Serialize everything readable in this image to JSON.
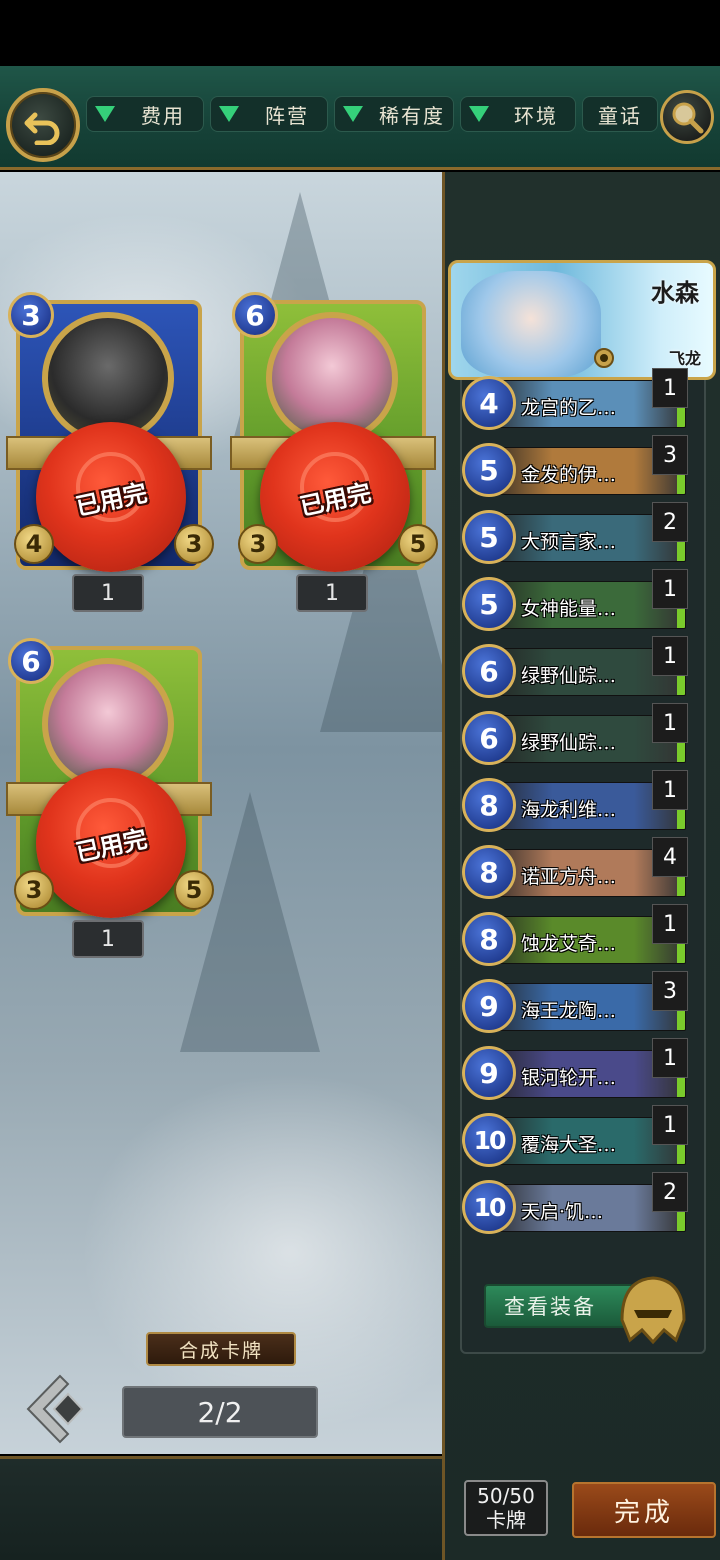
{
  "toolbar": {
    "filters": [
      {
        "label": "费用"
      },
      {
        "label": "阵营"
      },
      {
        "label": "稀有度"
      },
      {
        "label": "环境"
      }
    ],
    "fairy_tale_label": "童话"
  },
  "board": {
    "cards": [
      {
        "cost": "3",
        "atk": "4",
        "hp": "3",
        "count": "1",
        "seal": "已用完"
      },
      {
        "cost": "6",
        "atk": "3",
        "hp": "5",
        "count": "1",
        "seal": "已用完"
      },
      {
        "cost": "6",
        "atk": "3",
        "hp": "5",
        "count": "1",
        "seal": "已用完"
      }
    ],
    "synth_label": "合成卡牌",
    "page_counter": "2/2"
  },
  "leader": {
    "name": "水森",
    "class": "飞龙"
  },
  "deck": [
    {
      "cost": "4",
      "name": "龙宫的乙…",
      "count": "1",
      "color": "#5b8fb8"
    },
    {
      "cost": "5",
      "name": "金发的伊…",
      "count": "3",
      "color": "#b07a3c"
    },
    {
      "cost": "5",
      "name": "大预言家…",
      "count": "2",
      "color": "#3a6a7a"
    },
    {
      "cost": "5",
      "name": "女神能量…",
      "count": "1",
      "color": "#3b6a3a"
    },
    {
      "cost": "6",
      "name": "绿野仙踪…",
      "count": "1",
      "color": "#2f4a3e"
    },
    {
      "cost": "6",
      "name": "绿野仙踪…",
      "count": "1",
      "color": "#2f4a3e"
    },
    {
      "cost": "8",
      "name": "海龙利维…",
      "count": "1",
      "color": "#3a5a9a"
    },
    {
      "cost": "8",
      "name": "诺亚方舟…",
      "count": "4",
      "color": "#b07a5a"
    },
    {
      "cost": "8",
      "name": "蚀龙艾奇…",
      "count": "1",
      "color": "#5a8a2a"
    },
    {
      "cost": "9",
      "name": "海王龙陶…",
      "count": "3",
      "color": "#3a6aa8"
    },
    {
      "cost": "9",
      "name": "银河轮开…",
      "count": "1",
      "color": "#4a4a8a"
    },
    {
      "cost": "10",
      "name": "覆海大圣…",
      "count": "1",
      "color": "#2a6a6a"
    },
    {
      "cost": "10",
      "name": "天启·饥…",
      "count": "2",
      "color": "#6a7a9a"
    }
  ],
  "equip_label": "查看装备",
  "deck_count": {
    "value": "50/50",
    "label": "卡牌"
  },
  "done_label": "完成"
}
